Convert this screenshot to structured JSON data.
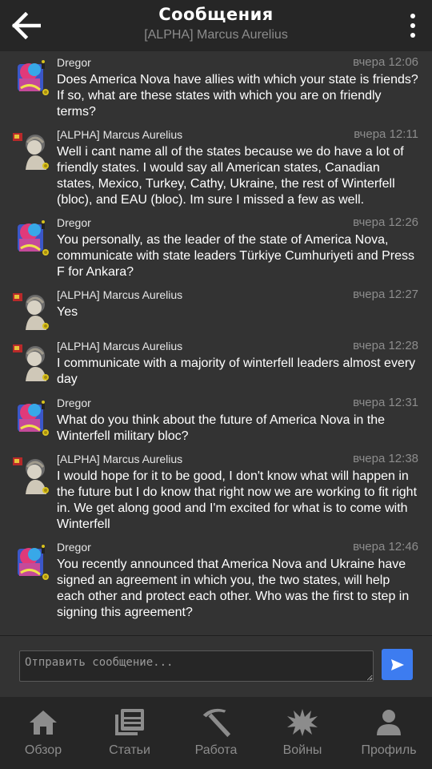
{
  "header": {
    "title": "Сообщения",
    "subtitle": "[ALPHA] Marcus Aurelius"
  },
  "icons": {
    "back": "arrow-left-icon",
    "more": "more-vertical-icon",
    "send": "send-icon"
  },
  "messages": [
    {
      "author": "Dregor",
      "time": "вчера 12:06",
      "avatar": "dregor",
      "text": "Does America Nova have allies with which your state is friends? If so, what are these states with which you are on friendly terms?"
    },
    {
      "author": "[ALPHA] Marcus Aurelius",
      "time": "вчера 12:11",
      "avatar": "marcus",
      "text": "Well i cant name all of the states because we do have a lot of friendly states. I would say all American states, Canadian states, Mexico, Turkey, Cathy, Ukraine, the rest of Winterfell (bloc), and EAU (bloc). Im sure I missed a few as well."
    },
    {
      "author": "Dregor",
      "time": "вчера 12:26",
      "avatar": "dregor",
      "text": "You personally, as the leader of the state of America Nova, communicate with state leaders Türkiye Cumhuriyeti and Press F for Ankara?"
    },
    {
      "author": "[ALPHA] Marcus Aurelius",
      "time": "вчера 12:27",
      "avatar": "marcus",
      "text": "Yes"
    },
    {
      "author": "[ALPHA] Marcus Aurelius",
      "time": "вчера 12:28",
      "avatar": "marcus",
      "text": "I communicate with a majority of winterfell leaders almost every day"
    },
    {
      "author": "Dregor",
      "time": "вчера 12:31",
      "avatar": "dregor",
      "text": "What do you think about the future of America Nova in the Winterfell military bloc?"
    },
    {
      "author": "[ALPHA] Marcus Aurelius",
      "time": "вчера 12:38",
      "avatar": "marcus",
      "text": "I would hope for it to be good, I don't know what will happen in the future but I do know that right now we are working to fit right in. We get along good and I'm excited for what is to come with Winterfell"
    },
    {
      "author": "Dregor",
      "time": "вчера 12:46",
      "avatar": "dregor",
      "text": "You recently announced that America Nova and Ukraine have signed an agreement in which you, the two states, will help each other and protect each other. Who was the first to step in signing this agreement?"
    }
  ],
  "composer": {
    "placeholder": "Отправить сообщение..."
  },
  "nav": [
    {
      "label": "Обзор",
      "icon": "home-icon"
    },
    {
      "label": "Статьи",
      "icon": "articles-icon"
    },
    {
      "label": "Работа",
      "icon": "pickaxe-icon"
    },
    {
      "label": "Войны",
      "icon": "explosion-icon"
    },
    {
      "label": "Профиль",
      "icon": "profile-icon"
    }
  ],
  "colors": {
    "background": "#333333",
    "header": "#262626",
    "accent": "#3d7cf0",
    "muted": "#8c8c8c"
  }
}
